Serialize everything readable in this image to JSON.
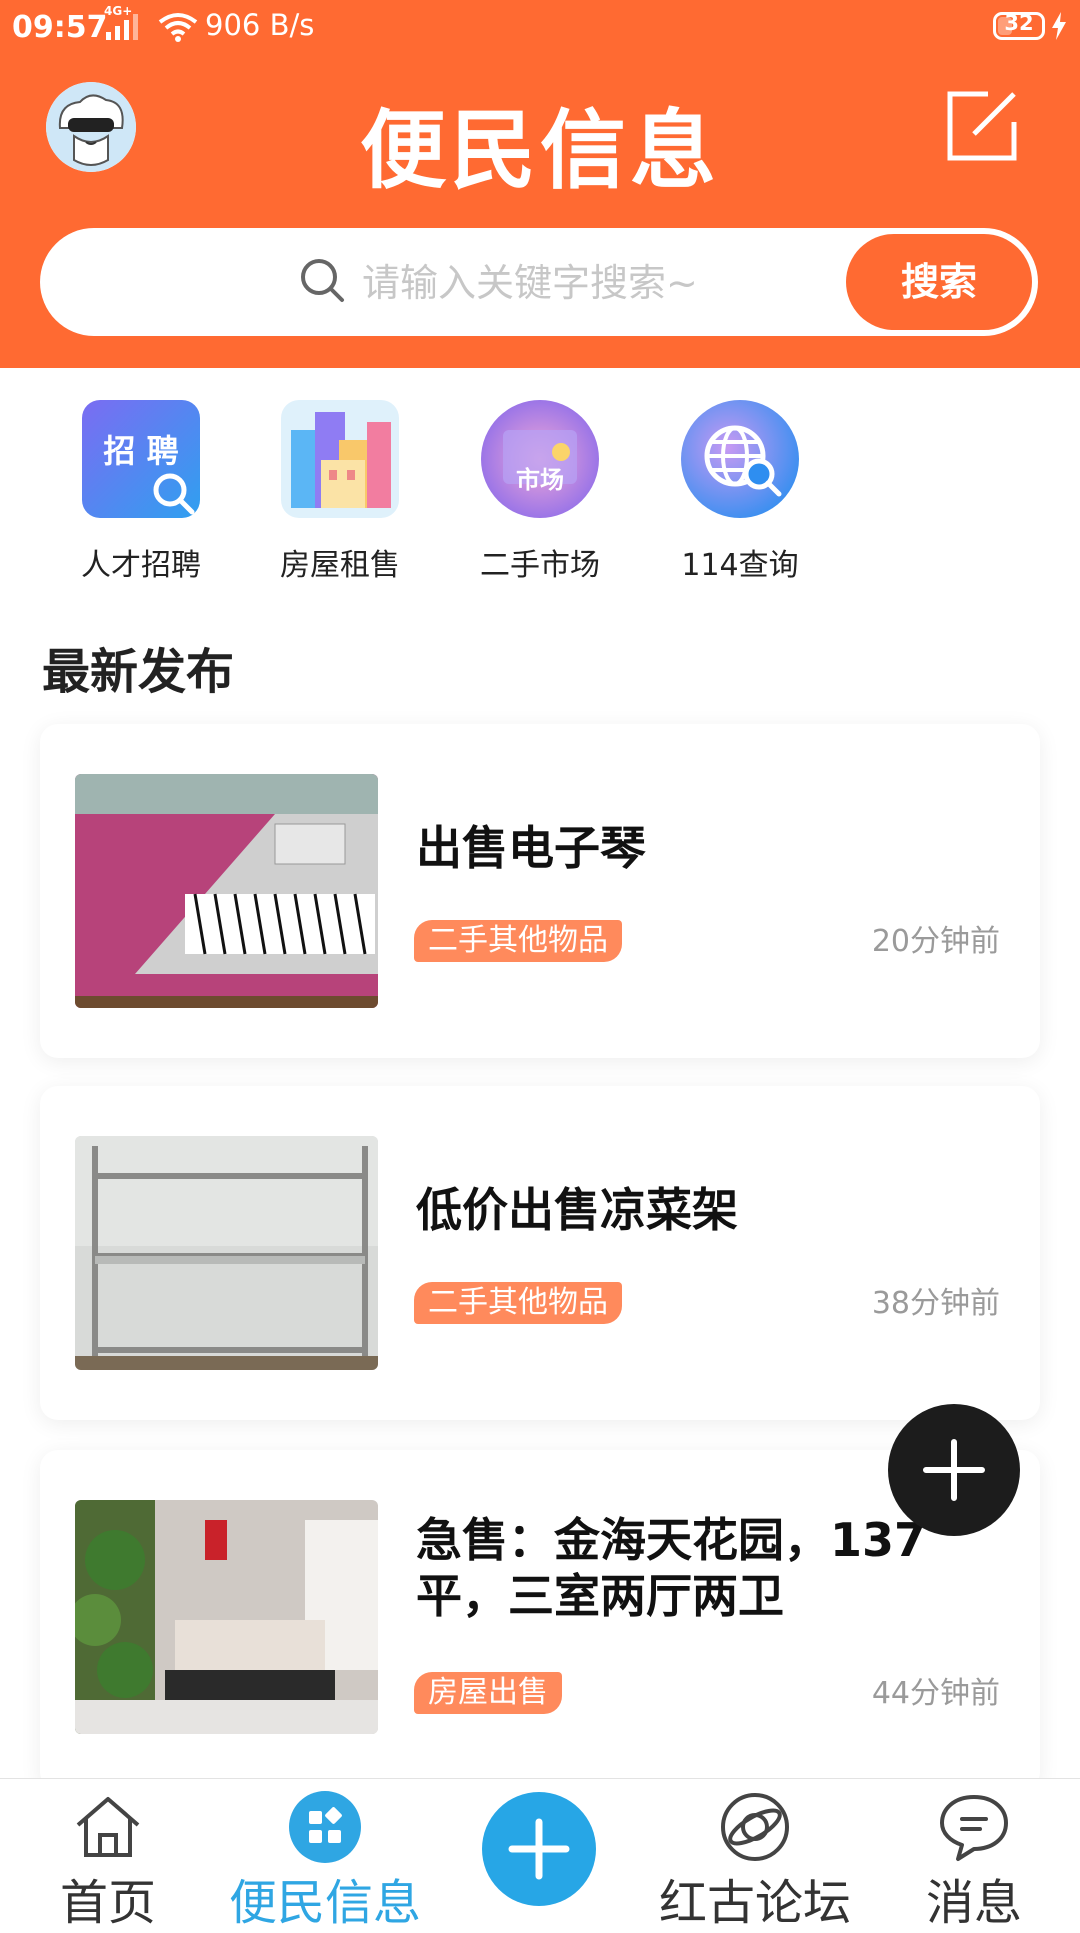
{
  "status_bar": {
    "time": "09:57",
    "network": "4G+",
    "speed": "906 B/s",
    "battery": "32"
  },
  "header": {
    "title": "便民信息",
    "avatar_icon": "avatar-cartoon-icon",
    "edit_icon": "edit-icon"
  },
  "search": {
    "placeholder": "请输入关键字搜索~",
    "value": "",
    "button_label": "搜索"
  },
  "categories": [
    {
      "label": "人才招聘",
      "icon": "recruitment-icon",
      "icon_text": "招 聘"
    },
    {
      "label": "房屋租售",
      "icon": "housing-icon"
    },
    {
      "label": "二手市场",
      "icon": "second-hand-market-icon",
      "icon_text": "市场"
    },
    {
      "label": "114查询",
      "icon": "globe-search-icon"
    }
  ],
  "section_title": "最新发布",
  "listings": [
    {
      "title": "出售电子琴",
      "tag": "二手其他物品",
      "time": "20分钟前"
    },
    {
      "title": "低价出售凉菜架",
      "tag": "二手其他物品",
      "time": "38分钟前"
    },
    {
      "title": "急售：金海天花园，137平，三室两厅两卫",
      "tag": "房屋出售",
      "time": "44分钟前"
    }
  ],
  "bottom_nav": [
    {
      "label": "首页",
      "icon": "home-icon"
    },
    {
      "label": "便民信息",
      "icon": "grid-icon",
      "active": true
    },
    {
      "label": "",
      "icon": "plus-icon"
    },
    {
      "label": "红古论坛",
      "icon": "planet-icon"
    },
    {
      "label": "消息",
      "icon": "chat-bubble-icon"
    }
  ],
  "colors": {
    "brand": "#FF6A32",
    "tag": "#FF8A5C",
    "active_nav": "#2FA6E3",
    "fab": "#1C1C1C"
  }
}
